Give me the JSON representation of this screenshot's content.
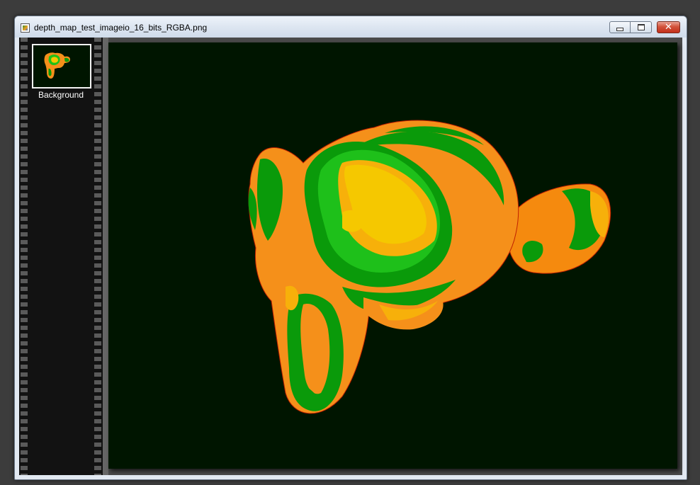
{
  "window": {
    "title": "depth_map_test_imageio_16_bits_RGBA.png",
    "icon": "image-file-icon",
    "controls": {
      "minimize": "minimize-icon",
      "maximize": "maximize-icon",
      "close": "close-icon",
      "close_glyph": "✕"
    }
  },
  "layers_panel": {
    "layers": [
      {
        "label": "Background",
        "selected": true
      }
    ]
  },
  "image": {
    "background_color": "#001500",
    "palette": {
      "orange": "#f5901a",
      "amber": "#f7b00a",
      "yellow": "#f5c800",
      "green": "#0a9a0a",
      "bright_green": "#1ec01a",
      "red_fringe": "#d02000"
    }
  }
}
